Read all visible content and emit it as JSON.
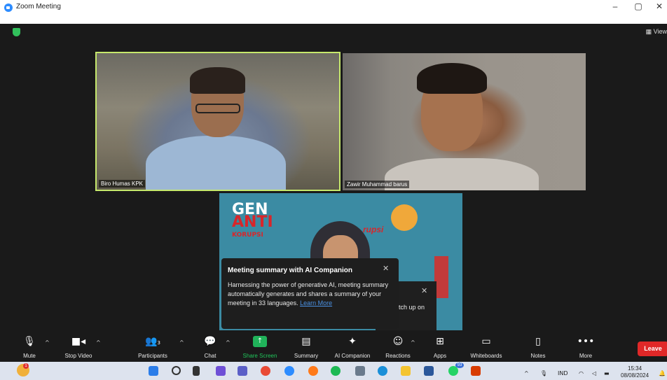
{
  "window": {
    "title": "Zoom Meeting",
    "controls": [
      "–",
      "▢",
      "✕"
    ],
    "view_label": "View"
  },
  "participants": [
    {
      "name": "Biro Humas KPK",
      "speaking": true
    },
    {
      "name": "Zawir Muhammad barus",
      "speaking": false
    }
  ],
  "shared_slide": {
    "logo_line1": "GEN",
    "logo_line2": "ANTI",
    "logo_line3": "KORUPSI",
    "fragment_text": "rupsi"
  },
  "tooltip": {
    "title": "Meeting summary with AI Companion",
    "body": "Harnessing the power of generative AI, meeting summary automatically generates and shares a summary of your meeting in 33 languages.",
    "link": "Learn More",
    "close": "✕"
  },
  "tooltip2": {
    "text": "tch up on",
    "close": "✕"
  },
  "toolbar": {
    "mute": "Mute",
    "stop_video": "Stop Video",
    "participants": "Participants",
    "participants_count": "3",
    "chat": "Chat",
    "share_screen": "Share Screen",
    "summary": "Summary",
    "ai_companion": "AI Companion",
    "reactions": "Reactions",
    "apps": "Apps",
    "whiteboards": "Whiteboards",
    "notes": "Notes",
    "more": "More",
    "leave": "Leave"
  },
  "taskbar": {
    "weather_badge": "1",
    "whatsapp_badge": "93",
    "lang": "IND",
    "time": "15:34",
    "date": "08/08/2024"
  },
  "colors": {
    "active_speaker_border": "#c6e86c",
    "share_green": "#20b35a",
    "leave_red": "#e02828",
    "link_blue": "#4a90e2"
  }
}
